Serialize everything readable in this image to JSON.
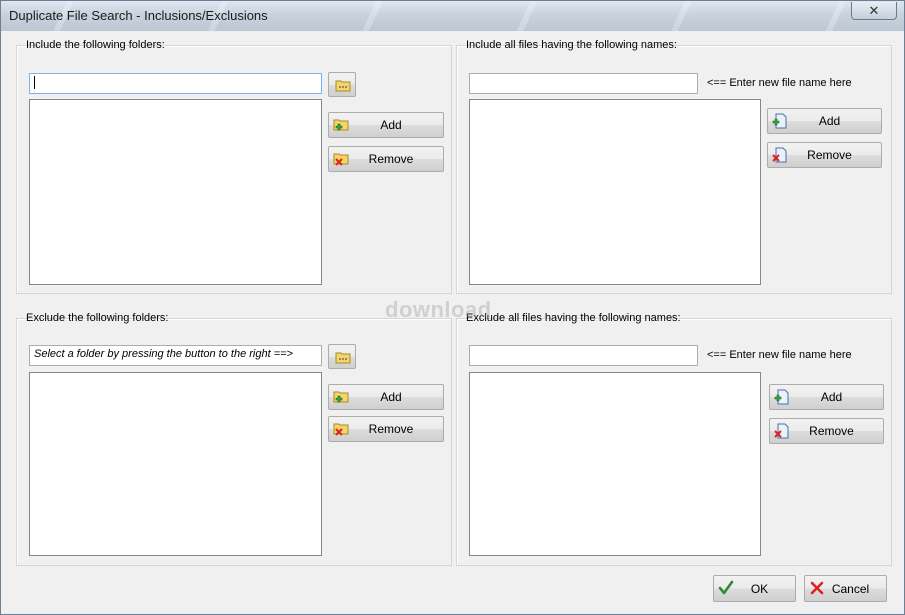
{
  "window": {
    "title": "Duplicate File Search - Inclusions/Exclusions",
    "close_glyph": "✕"
  },
  "include_folders": {
    "label": "Include the following folders:",
    "path_value": "",
    "add_label": "Add",
    "remove_label": "Remove"
  },
  "include_files": {
    "label": "Include all files having the following names:",
    "name_value": "",
    "hint": "<== Enter new file name here",
    "add_label": "Add",
    "remove_label": "Remove"
  },
  "exclude_folders": {
    "label": "Exclude the following folders:",
    "path_value": "Select a folder by pressing the button to the right ==>",
    "add_label": "Add",
    "remove_label": "Remove"
  },
  "exclude_files": {
    "label": "Exclude all files having the following names:",
    "name_value": "",
    "hint": "<== Enter new file name here",
    "add_label": "Add",
    "remove_label": "Remove"
  },
  "footer": {
    "ok_label": "OK",
    "cancel_label": "Cancel"
  },
  "watermark": "download",
  "icons": {
    "browse": "folder-browse-icon",
    "add_folder": "folder-add-icon",
    "remove_folder": "folder-remove-icon",
    "add_file": "file-add-icon",
    "remove_file": "file-remove-icon",
    "ok": "checkmark-icon",
    "cancel": "x-icon"
  }
}
